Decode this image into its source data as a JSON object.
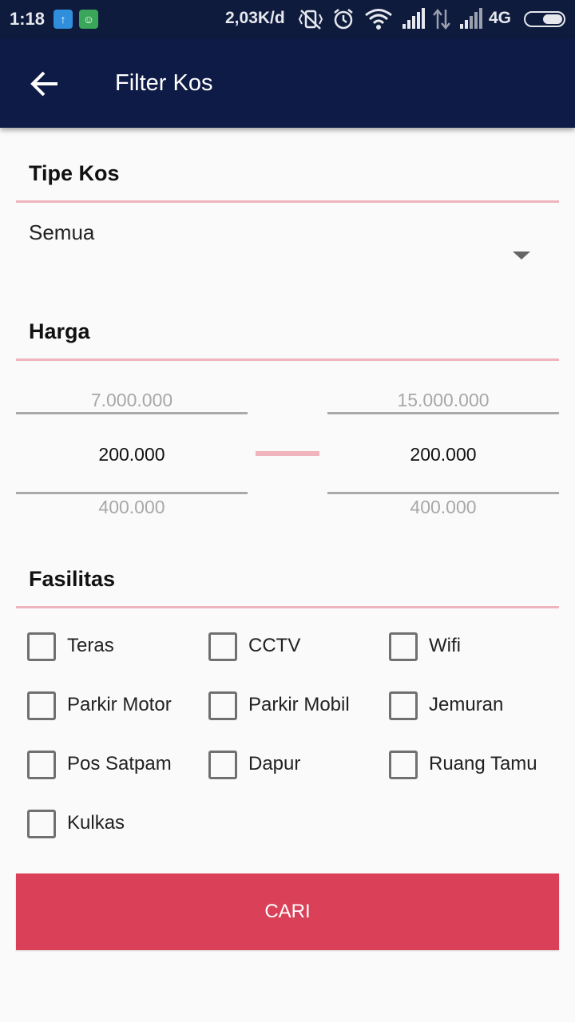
{
  "status_bar": {
    "time": "1:18",
    "net_speed": "2,03K/d",
    "network_type": "4G",
    "battery_level": 0.55,
    "icons": [
      "upload-notification-icon",
      "android-app-icon",
      "vibrate-off-icon",
      "alarm-icon",
      "wifi-icon",
      "signal-icon",
      "data-transfer-icon",
      "signal-weak-icon",
      "battery-icon"
    ]
  },
  "app_bar": {
    "title": "Filter Kos",
    "back_icon": "arrow-left-icon"
  },
  "tipe_kos": {
    "label": "Tipe Kos",
    "selected": "Semua"
  },
  "harga": {
    "label": "Harga",
    "min": {
      "prev": "7.000.000",
      "current": "200.000",
      "next": "400.000"
    },
    "max": {
      "prev": "15.000.000",
      "current": "200.000",
      "next": "400.000"
    }
  },
  "fasilitas": {
    "label": "Fasilitas",
    "items": [
      {
        "label": "Teras",
        "checked": false
      },
      {
        "label": "CCTV",
        "checked": false
      },
      {
        "label": "Wifi",
        "checked": false
      },
      {
        "label": "Parkir Motor",
        "checked": false
      },
      {
        "label": "Parkir Mobil",
        "checked": false
      },
      {
        "label": "Jemuran",
        "checked": false
      },
      {
        "label": "Pos Satpam",
        "checked": false
      },
      {
        "label": "Dapur",
        "checked": false
      },
      {
        "label": "Ruang Tamu",
        "checked": false
      },
      {
        "label": "Kulkas",
        "checked": false
      }
    ]
  },
  "search_button": {
    "label": "CARI"
  },
  "colors": {
    "app_bar": "#0e1b46",
    "status_bar": "#0e1b3d",
    "accent": "#da4158",
    "divider": "#efb4be",
    "background": "#fafafa"
  }
}
